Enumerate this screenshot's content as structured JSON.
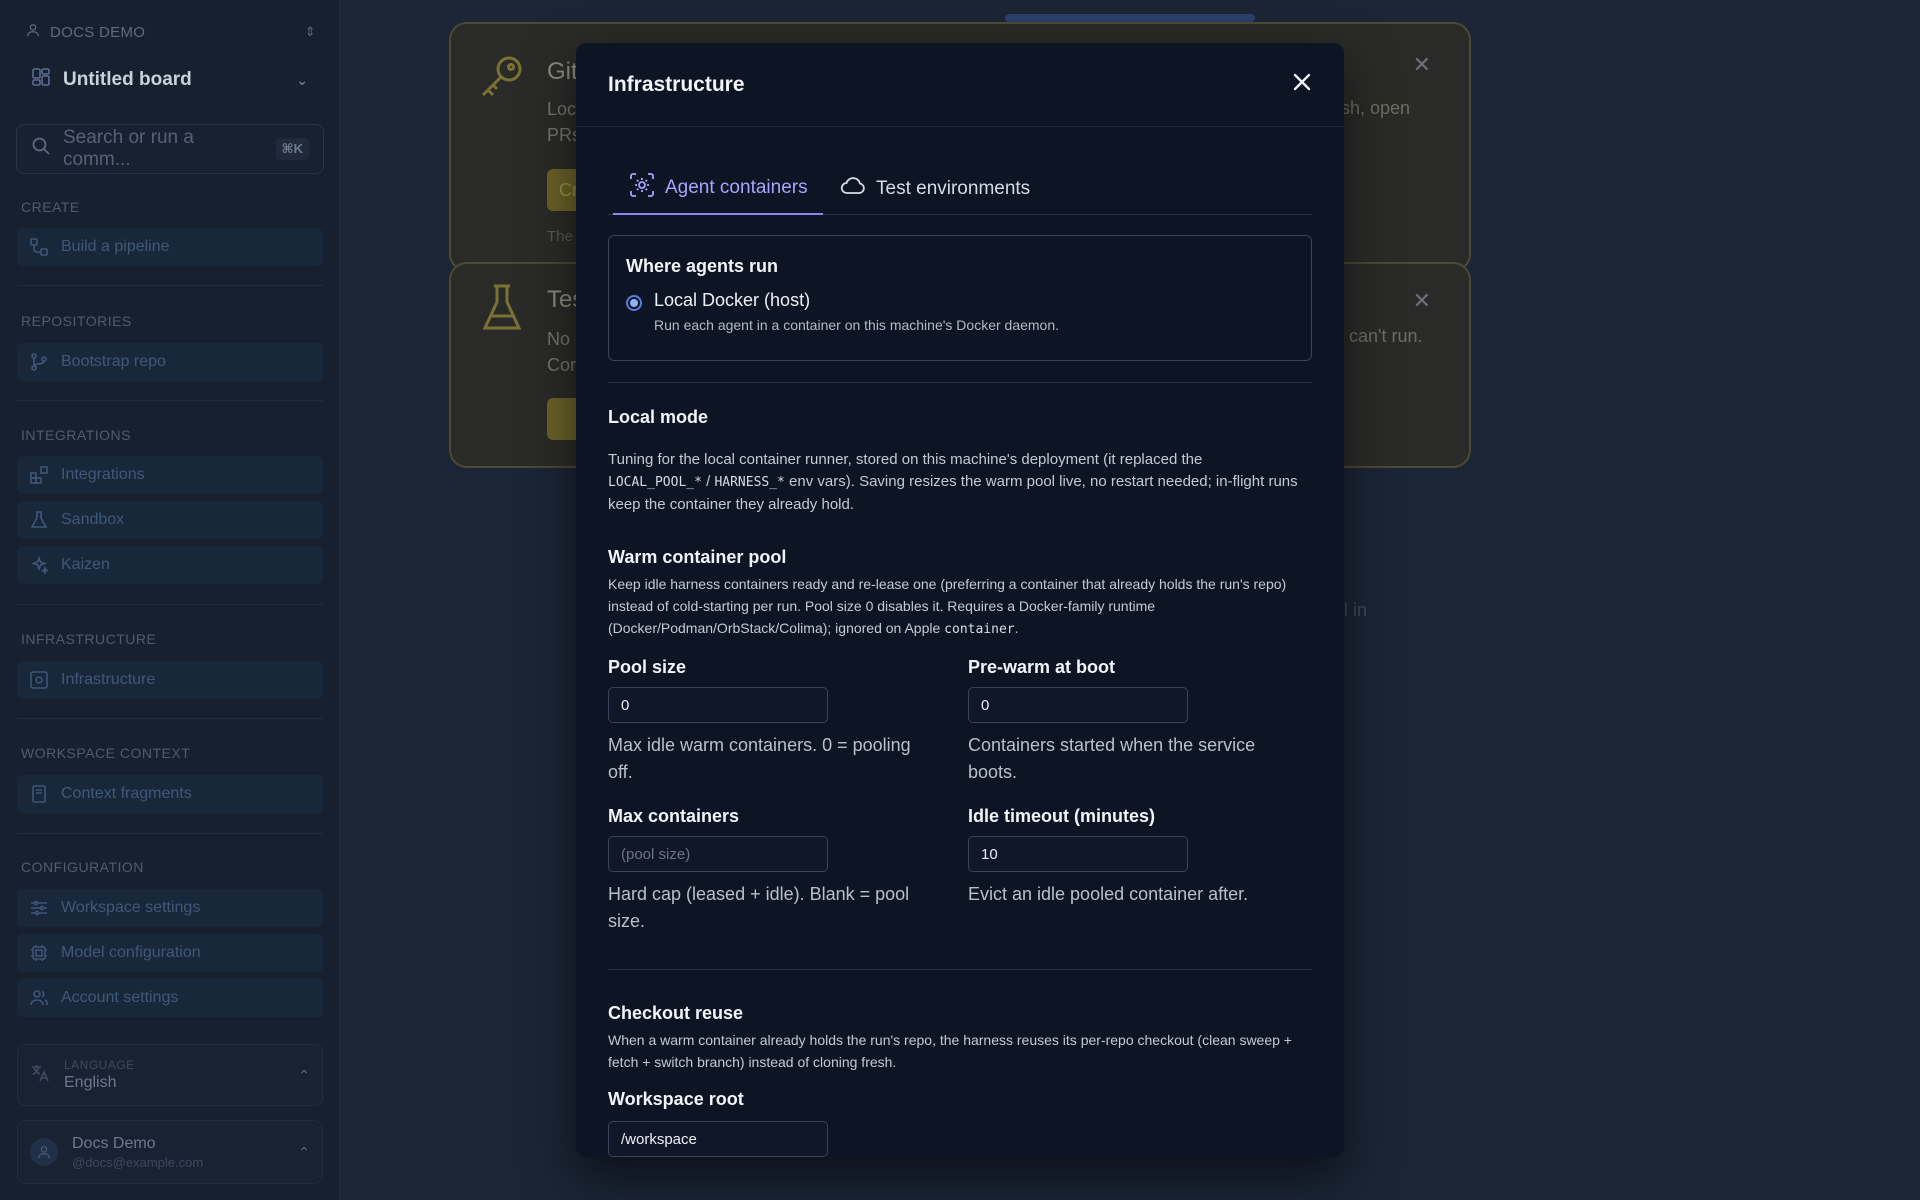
{
  "sidebar": {
    "workspace": "DOCS DEMO",
    "board": "Untitled board",
    "search": {
      "placeholder": "Search or run a comm...",
      "shortcut": "⌘K"
    },
    "sections": {
      "create": "CREATE",
      "repositories": "REPOSITORIES",
      "integrations": "INTEGRATIONS",
      "infrastructure": "INFRASTRUCTURE",
      "workspace_context": "WORKSPACE CONTEXT",
      "configuration": "CONFIGURATION"
    },
    "items": {
      "build_pipeline": "Build a pipeline",
      "bootstrap_repo": "Bootstrap repo",
      "integrations": "Integrations",
      "sandbox": "Sandbox",
      "kaizen": "Kaizen",
      "infrastructure": "Infrastructure",
      "context_fragments": "Context fragments",
      "workspace_settings": "Workspace settings",
      "model_configuration": "Model configuration",
      "account_settings": "Account settings"
    },
    "language": {
      "label": "LANGUAGE",
      "value": "English"
    },
    "user": {
      "name": "Docs Demo",
      "email": "@docs@example.com"
    }
  },
  "background": {
    "card1": {
      "title": "Git",
      "body_line1": "Loc",
      "body_line2": "PRs",
      "button": "Cr",
      "footer": "The",
      "right_text": "ush, open"
    },
    "card2": {
      "title": "Tes",
      "body_line1": "No",
      "body_line2": "Cor",
      "right_text": "can't run."
    },
    "ghost_text": "ull in"
  },
  "modal": {
    "title": "Infrastructure",
    "tabs": {
      "agent_containers": "Agent containers",
      "test_environments": "Test environments"
    },
    "where": {
      "title": "Where agents run",
      "option_label": "Local Docker (host)",
      "option_desc": "Run each agent in a container on this machine's Docker daemon."
    },
    "local_mode": {
      "heading": "Local mode",
      "text_a": "Tuning for the local container runner, stored on this machine's deployment (it replaced the",
      "code_1": "LOCAL_POOL_*",
      "sep": " / ",
      "code_2": "HARNESS_*",
      "text_b": " env vars). Saving resizes the warm pool live, no restart needed; in-flight runs keep the container they already hold."
    },
    "warm_pool": {
      "heading": "Warm container pool",
      "text_a": "Keep idle harness containers ready and re-lease one (preferring a container that already holds the run's repo) instead of cold-starting per run. Pool size 0 disables it. Requires a Docker-family runtime (Docker/Podman/OrbStack/Colima); ignored on Apple ",
      "code": "container",
      "text_b": "."
    },
    "fields": {
      "pool_size": {
        "label": "Pool size",
        "value": "0",
        "help": "Max idle warm containers. 0 = pooling off."
      },
      "prewarm": {
        "label": "Pre-warm at boot",
        "value": "0",
        "help": "Containers started when the service boots."
      },
      "max_containers": {
        "label": "Max containers",
        "value": "",
        "placeholder": "(pool size)",
        "help": "Hard cap (leased + idle). Blank = pool size."
      },
      "idle_timeout": {
        "label": "Idle timeout (minutes)",
        "value": "10",
        "help": "Evict an idle pooled container after."
      }
    },
    "checkout_reuse": {
      "heading": "Checkout reuse",
      "text": "When a warm container already holds the run's repo, the harness reuses its per-repo checkout (clean sweep + fetch + switch branch) instead of cloning fresh."
    },
    "workspace_root": {
      "label": "Workspace root",
      "value": "/workspace"
    }
  }
}
